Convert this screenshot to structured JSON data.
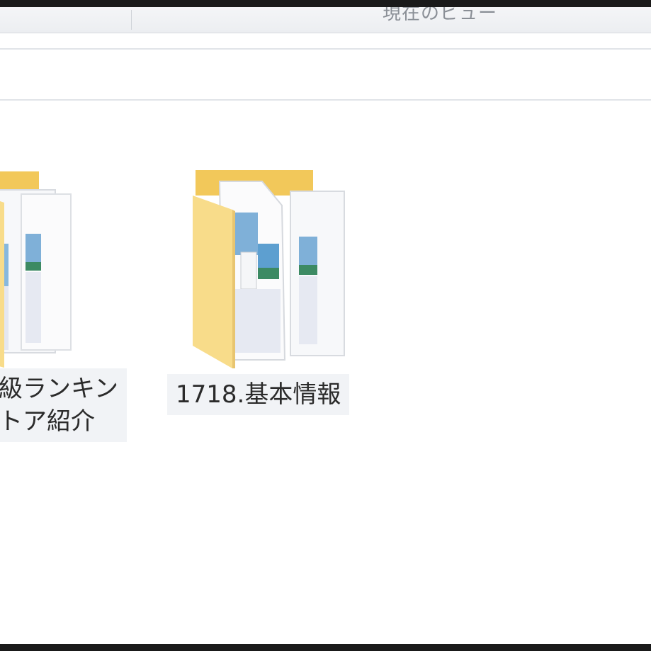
{
  "window": {
    "title_partial": "現在のビュー"
  },
  "items": [
    {
      "name_line1": "級ランキン",
      "name_line2": "トア紹介"
    },
    {
      "name": "1718.基本情報"
    }
  ],
  "colors": {
    "folder_front": "#f8dc8a",
    "folder_back": "#f2c85a",
    "label_background": "#f1f3f6",
    "window_frame": "#1a1a1a"
  },
  "icons": {
    "folder": "folder-with-documents-icon"
  }
}
